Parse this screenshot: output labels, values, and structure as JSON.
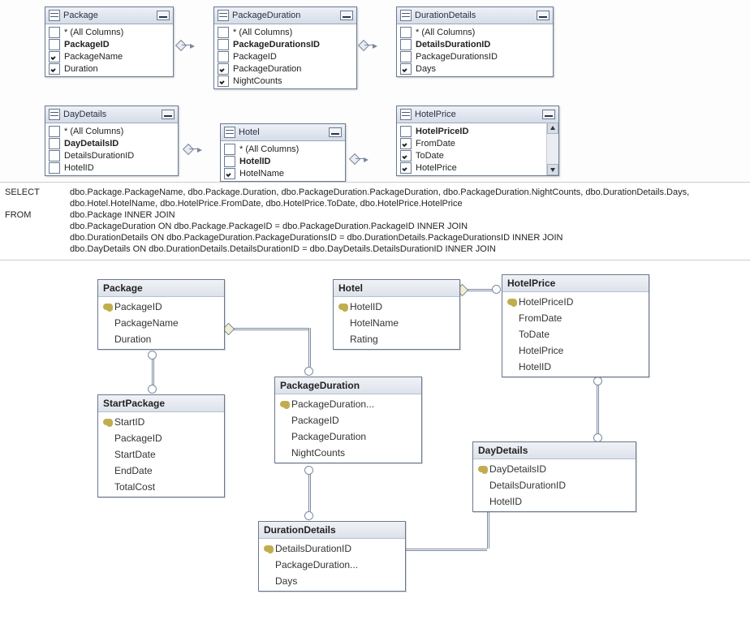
{
  "queryBoxes": {
    "package": {
      "title": "Package",
      "rows": [
        {
          "label": "* (All Columns)",
          "checked": false,
          "bold": false
        },
        {
          "label": "PackageID",
          "checked": false,
          "bold": true
        },
        {
          "label": "PackageName",
          "checked": true,
          "bold": false
        },
        {
          "label": "Duration",
          "checked": true,
          "bold": false
        }
      ]
    },
    "packageduration": {
      "title": "PackageDuration",
      "rows": [
        {
          "label": "* (All Columns)",
          "checked": false,
          "bold": false
        },
        {
          "label": "PackageDurationsID",
          "checked": false,
          "bold": true
        },
        {
          "label": "PackageID",
          "checked": false,
          "bold": false
        },
        {
          "label": "PackageDuration",
          "checked": true,
          "bold": false
        },
        {
          "label": "NightCounts",
          "checked": true,
          "bold": false
        }
      ]
    },
    "durationdetails": {
      "title": "DurationDetails",
      "rows": [
        {
          "label": "* (All Columns)",
          "checked": false,
          "bold": false
        },
        {
          "label": "DetailsDurationID",
          "checked": false,
          "bold": true
        },
        {
          "label": "PackageDurationsID",
          "checked": false,
          "bold": false
        },
        {
          "label": "Days",
          "checked": true,
          "bold": false
        }
      ]
    },
    "daydetails": {
      "title": "DayDetails",
      "rows": [
        {
          "label": "* (All Columns)",
          "checked": false,
          "bold": false
        },
        {
          "label": "DayDetailsID",
          "checked": false,
          "bold": true
        },
        {
          "label": "DetailsDurationID",
          "checked": false,
          "bold": false
        },
        {
          "label": "HotelID",
          "checked": false,
          "bold": false
        }
      ]
    },
    "hotel": {
      "title": "Hotel",
      "rows": [
        {
          "label": "* (All Columns)",
          "checked": false,
          "bold": false
        },
        {
          "label": "HotelID",
          "checked": false,
          "bold": true
        },
        {
          "label": "HotelName",
          "checked": true,
          "bold": false
        }
      ]
    },
    "hotelprice": {
      "title": "HotelPrice",
      "rows": [
        {
          "label": "HotelPriceID",
          "checked": false,
          "bold": true
        },
        {
          "label": "FromDate",
          "checked": true,
          "bold": false
        },
        {
          "label": "ToDate",
          "checked": true,
          "bold": false
        },
        {
          "label": "HotelPrice",
          "checked": true,
          "bold": false
        }
      ]
    }
  },
  "sql": {
    "line1kw": "SELECT",
    "line1": "dbo.Package.PackageName, dbo.Package.Duration, dbo.PackageDuration.PackageDuration, dbo.PackageDuration.NightCounts, dbo.DurationDetails.Days,",
    "line2": "dbo.Hotel.HotelName, dbo.HotelPrice.FromDate, dbo.HotelPrice.ToDate, dbo.HotelPrice.HotelPrice",
    "line3kw": "FROM",
    "line3": "dbo.Package INNER JOIN",
    "line4": "dbo.PackageDuration ON dbo.Package.PackageID = dbo.PackageDuration.PackageID INNER JOIN",
    "line5": "dbo.DurationDetails ON dbo.PackageDuration.PackageDurationsID = dbo.DurationDetails.PackageDurationsID INNER JOIN",
    "line6": "dbo.DayDetails ON dbo.DurationDetails.DetailsDurationID = dbo.DayDetails.DetailsDurationID INNER JOIN"
  },
  "er": {
    "package": {
      "name": "Package",
      "cols": [
        {
          "name": "PackageID",
          "pk": true
        },
        {
          "name": "PackageName",
          "pk": false
        },
        {
          "name": "Duration",
          "pk": false
        }
      ]
    },
    "startpackage": {
      "name": "StartPackage",
      "cols": [
        {
          "name": "StartID",
          "pk": true
        },
        {
          "name": "PackageID",
          "pk": false
        },
        {
          "name": "StartDate",
          "pk": false
        },
        {
          "name": "EndDate",
          "pk": false
        },
        {
          "name": "TotalCost",
          "pk": false
        }
      ]
    },
    "hotel": {
      "name": "Hotel",
      "cols": [
        {
          "name": "HotelID",
          "pk": true
        },
        {
          "name": "HotelName",
          "pk": false
        },
        {
          "name": "Rating",
          "pk": false
        }
      ]
    },
    "packageduration": {
      "name": "PackageDuration",
      "cols": [
        {
          "name": "PackageDuration...",
          "pk": true
        },
        {
          "name": "PackageID",
          "pk": false
        },
        {
          "name": "PackageDuration",
          "pk": false
        },
        {
          "name": "NightCounts",
          "pk": false
        }
      ]
    },
    "durationdetails": {
      "name": "DurationDetails",
      "cols": [
        {
          "name": "DetailsDurationID",
          "pk": true
        },
        {
          "name": "PackageDuration...",
          "pk": false
        },
        {
          "name": "Days",
          "pk": false
        }
      ]
    },
    "daydetails": {
      "name": "DayDetails",
      "cols": [
        {
          "name": "DayDetailsID",
          "pk": true
        },
        {
          "name": "DetailsDurationID",
          "pk": false
        },
        {
          "name": "HotelID",
          "pk": false
        }
      ]
    },
    "hotelprice": {
      "name": "HotelPrice",
      "cols": [
        {
          "name": "HotelPriceID",
          "pk": true
        },
        {
          "name": "FromDate",
          "pk": false
        },
        {
          "name": "ToDate",
          "pk": false
        },
        {
          "name": "HotelPrice",
          "pk": false
        },
        {
          "name": "HotelID",
          "pk": false
        }
      ]
    }
  }
}
